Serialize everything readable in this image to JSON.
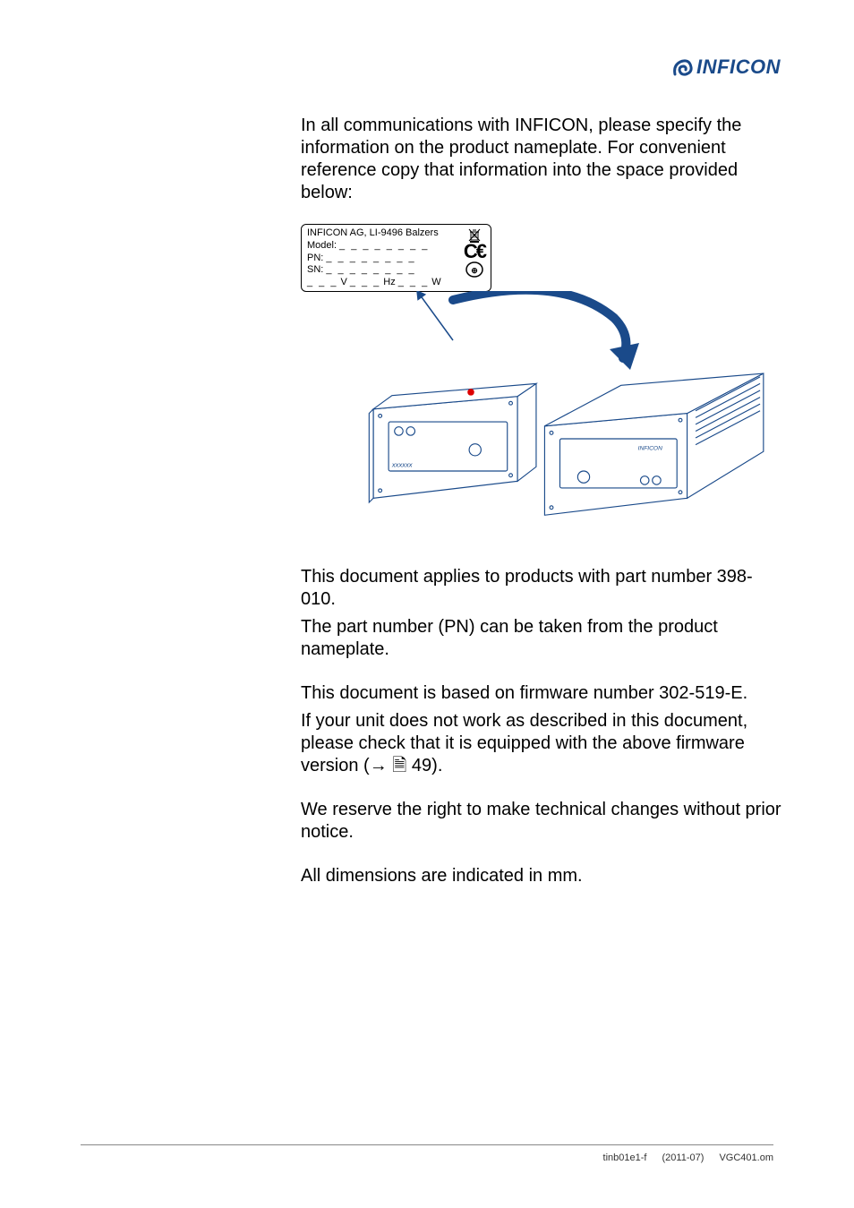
{
  "brand": {
    "name": "INFICON"
  },
  "intro": "In all communications with INFICON, please specify the information on the product nameplate. For convenient reference copy that information into the space provided below:",
  "nameplate": {
    "company": "INFICON AG, LI-9496 Balzers",
    "model_label": "Model:",
    "pn_label": "PN:",
    "sn_label": "SN:",
    "v_label": "V",
    "hz_label": "Hz",
    "w_label": "W",
    "dashes8": "_ _ _ _ _ _ _ _",
    "dashes3": "_ _ _"
  },
  "body": {
    "p1": "This document applies to products with part number 398-010.",
    "p2": "The part number (PN) can be taken from the product nameplate.",
    "p3": "This document is based on firmware number 302-519-E.",
    "p4a": "If your unit does not work as described in this document, please check that it is equipped with the above firmware version (",
    "p4_arrow": "→",
    "p4_pageicon": "🗎",
    "p4_ref": " 49).",
    "p5": "We reserve the right to make technical changes without prior notice.",
    "p6": "All dimensions are indicated in mm."
  },
  "footer": {
    "doc": "tinb01e1-f",
    "date": "(2011-07)",
    "om": "VGC401.om"
  }
}
